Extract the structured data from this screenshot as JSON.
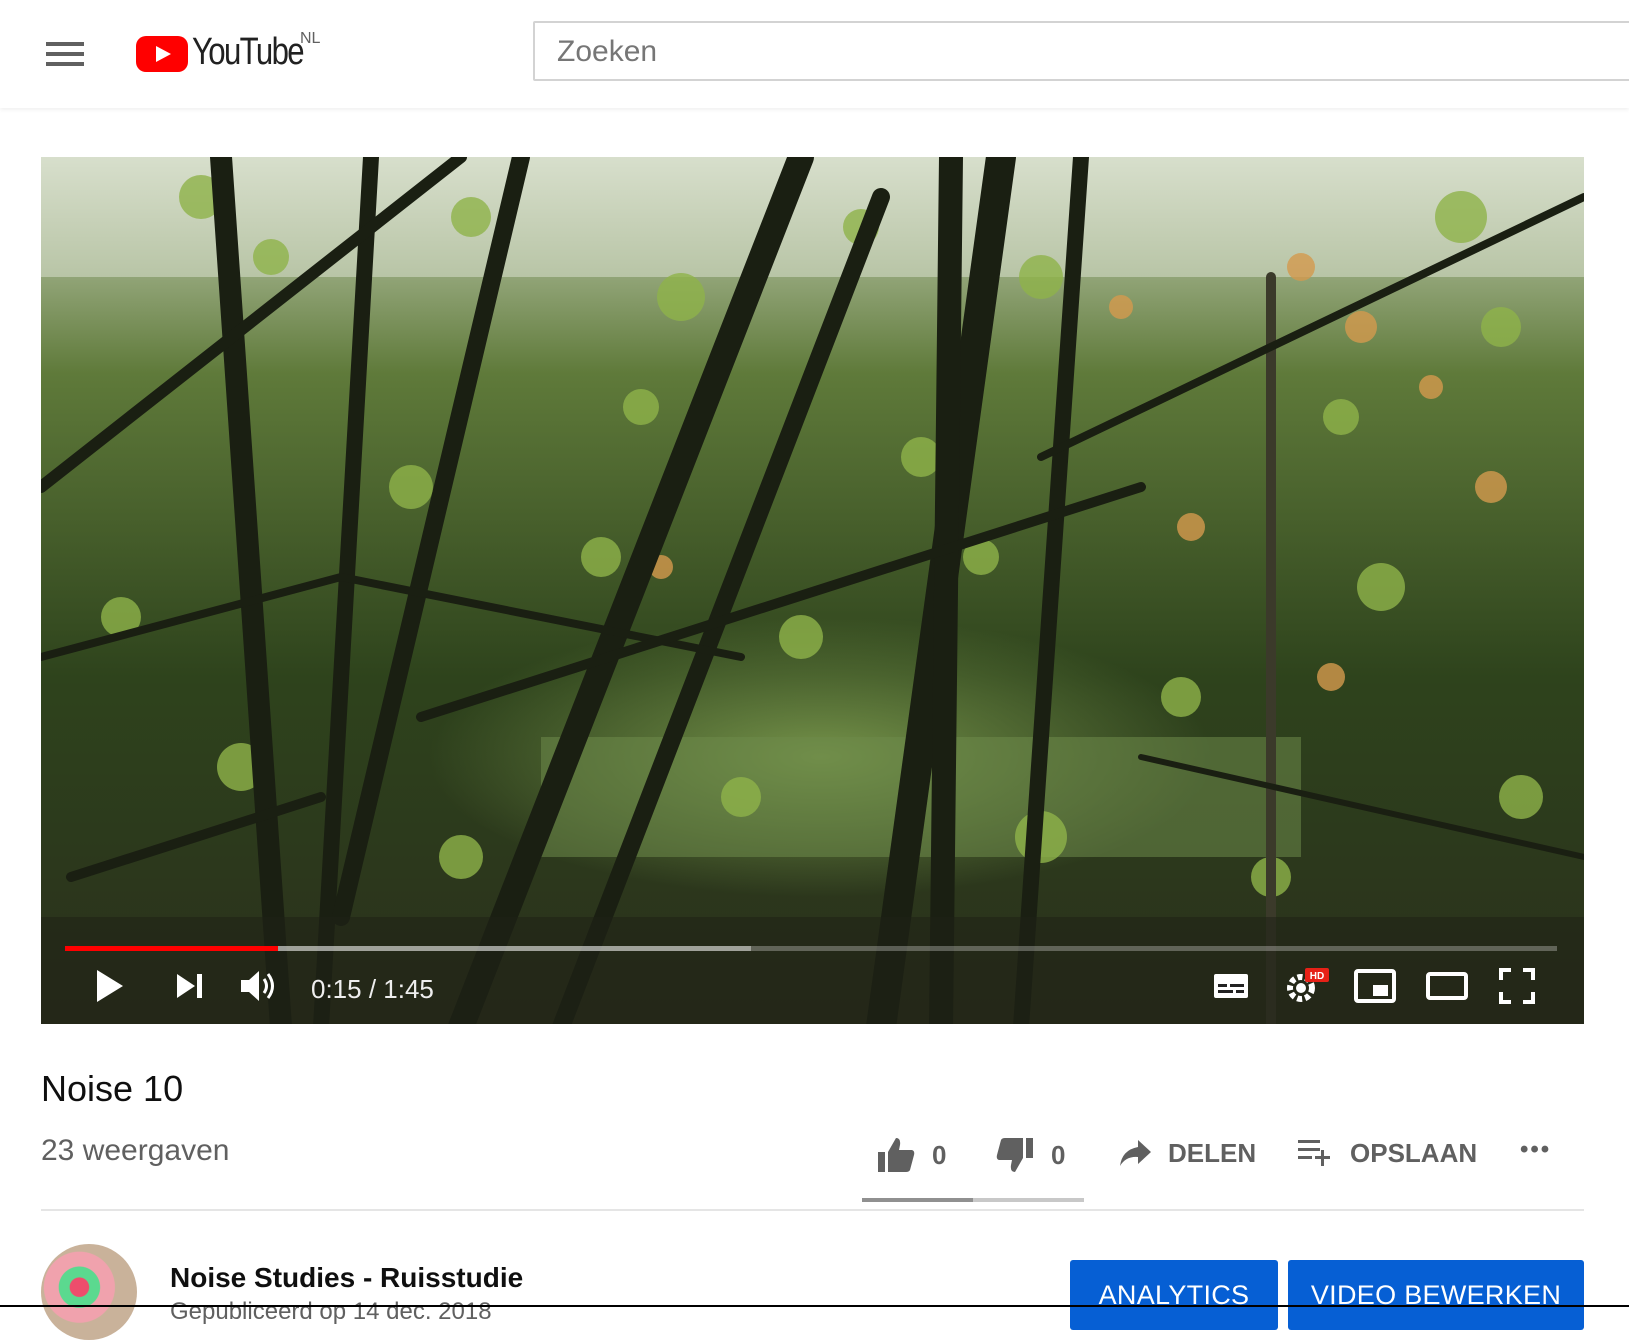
{
  "header": {
    "logo_text": "YouTube",
    "country_code": "NL",
    "search_placeholder": "Zoeken"
  },
  "player": {
    "time_current": "0:15",
    "time_total": "1:45",
    "time_display": "0:15 / 1:45",
    "progress_fraction": 0.143,
    "buffered_fraction": 0.46,
    "quality_badge": "HD",
    "colors": {
      "progress": "#ff0000"
    }
  },
  "video": {
    "title": "Noise 10",
    "views": "23 weergaven"
  },
  "actions": {
    "like_count": "0",
    "dislike_count": "0",
    "share_label": "DELEN",
    "save_label": "OPSLAAN",
    "more_label": "•••"
  },
  "channel": {
    "name": "Noise Studies - Ruisstudie",
    "published": "Gepubliceerd op 14 dec. 2018"
  },
  "owner_buttons": {
    "analytics": "ANALYTICS",
    "edit": "VIDEO BEWERKEN",
    "color": "#065fd4"
  }
}
